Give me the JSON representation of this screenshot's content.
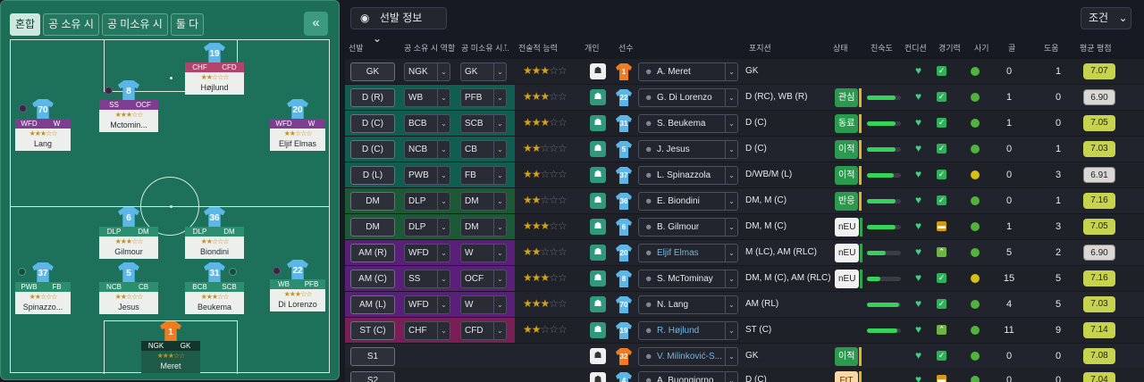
{
  "pitch": {
    "tabs": [
      "혼합",
      "공 소유 시",
      "공 미소유 시",
      "둘 다"
    ],
    "active_tab": "혼합",
    "collapse_label": "«",
    "tokens": [
      {
        "num": "19",
        "roles": [
          "CHF",
          "CFD"
        ],
        "stars": "★★☆☆☆",
        "name": "Højlund",
        "kit": "outfield",
        "scheme": "pk"
      },
      {
        "num": "8",
        "roles": [
          "SS",
          "OCF"
        ],
        "stars": "★★★☆☆",
        "name": "Mctomin...",
        "kit": "outfield",
        "scheme": "pur"
      },
      {
        "num": "70",
        "roles": [
          "WFD",
          "W"
        ],
        "stars": "★★★☆☆",
        "name": "Lang",
        "kit": "outfield",
        "scheme": "pur"
      },
      {
        "num": "20",
        "roles": [
          "WFD",
          "W"
        ],
        "stars": "★★☆☆☆",
        "name": "Eljif Elmas",
        "kit": "outfield",
        "scheme": "pur"
      },
      {
        "num": "6",
        "roles": [
          "DLP",
          "DM"
        ],
        "stars": "★★★☆☆",
        "name": "Gilmour",
        "kit": "outfield",
        "scheme": "gr"
      },
      {
        "num": "36",
        "roles": [
          "DLP",
          "DM"
        ],
        "stars": "★★☆☆☆",
        "name": "Biondini",
        "kit": "outfield",
        "scheme": "gr"
      },
      {
        "num": "37",
        "roles": [
          "PWB",
          "FB"
        ],
        "stars": "★★☆☆☆",
        "name": "Spinazzo...",
        "kit": "outfield",
        "scheme": "gr"
      },
      {
        "num": "5",
        "roles": [
          "NCB",
          "CB"
        ],
        "stars": "★★☆☆☆",
        "name": "Jesus",
        "kit": "outfield",
        "scheme": "gr"
      },
      {
        "num": "31",
        "roles": [
          "BCB",
          "SCB"
        ],
        "stars": "★★★☆☆",
        "name": "Beukema",
        "kit": "outfield",
        "scheme": "gr"
      },
      {
        "num": "22",
        "roles": [
          "WB",
          "PFB"
        ],
        "stars": "★★★☆☆",
        "name": "Di Lorenzo",
        "kit": "outfield",
        "scheme": "gr"
      },
      {
        "num": "1",
        "roles": [
          "NGK",
          "GK"
        ],
        "stars": "★★★☆☆",
        "name": "Meret",
        "kit": "gk",
        "scheme": "dk"
      }
    ]
  },
  "toolbar": {
    "view_label": "선발 정보",
    "filter_label": "조건"
  },
  "columns": {
    "sel": "선발",
    "role": "공 소유 시 역할",
    "duty": "공 미소유 시...",
    "stars": "전술적 능력",
    "person": "개인",
    "player": "선수",
    "position": "포지션",
    "status": "상태",
    "familiarity": "친숙도",
    "condition": "컨디션",
    "fitness": "경기력",
    "morale": "사기",
    "goals": "골",
    "assists": "도움",
    "rating": "평균 평점"
  },
  "accent": {
    "gk": "#2d3039",
    "def": "#0f6e5c",
    "mid": "#1f6e40",
    "att": "#6a1f8a",
    "st": "#8a1f5a"
  },
  "rows": [
    {
      "sel": "GK",
      "role": "NGK",
      "duty": "GK",
      "stars": "★★★",
      "stars_off": "☆☆",
      "person": "w",
      "num": "1",
      "kit": "gk",
      "name": "A. Meret",
      "blue": false,
      "pos": "GK",
      "status": "",
      "status_cls": "",
      "fam": 0,
      "fit": "check",
      "morale": "g",
      "goals": "0",
      "assists": "1",
      "rating": "7.07",
      "rating_cls": "",
      "strip": "gk"
    },
    {
      "sel": "D (R)",
      "role": "WB",
      "duty": "PFB",
      "stars": "★★★",
      "stars_off": "☆☆",
      "person": "g",
      "num": "22",
      "kit": "out",
      "name": "G. Di Lorenzo",
      "blue": false,
      "pos": "D (RC), WB (R)",
      "status": "관심",
      "status_cls": "s-green",
      "fam": 85,
      "fit": "check",
      "morale": "g",
      "goals": "1",
      "assists": "0",
      "rating": "6.90",
      "rating_cls": "gray",
      "strip": "def"
    },
    {
      "sel": "D (C)",
      "role": "BCB",
      "duty": "SCB",
      "stars": "★★★",
      "stars_off": "☆☆",
      "person": "g",
      "num": "31",
      "kit": "out",
      "name": "S. Beukema",
      "blue": false,
      "pos": "D (C)",
      "status": "동료",
      "status_cls": "s-green",
      "fam": 85,
      "fit": "check",
      "morale": "g",
      "goals": "1",
      "assists": "0",
      "rating": "7.05",
      "rating_cls": "",
      "strip": "def"
    },
    {
      "sel": "D (C)",
      "role": "NCB",
      "duty": "CB",
      "stars": "★★",
      "stars_off": "☆☆☆",
      "person": "g",
      "num": "5",
      "kit": "out",
      "name": "J. Jesus",
      "blue": false,
      "pos": "D (C)",
      "status": "이적",
      "status_cls": "s-green",
      "fam": 85,
      "fit": "check",
      "morale": "g",
      "goals": "0",
      "assists": "1",
      "rating": "7.03",
      "rating_cls": "",
      "strip": "def"
    },
    {
      "sel": "D (L)",
      "role": "PWB",
      "duty": "FB",
      "stars": "★★",
      "stars_off": "☆☆☆",
      "person": "g",
      "num": "37",
      "kit": "out",
      "name": "L. Spinazzola",
      "blue": false,
      "pos": "D/WB/M (L)",
      "status": "이적",
      "status_cls": "s-green",
      "fam": 80,
      "fit": "check",
      "morale": "y",
      "goals": "0",
      "assists": "3",
      "rating": "6.91",
      "rating_cls": "gray",
      "strip": "def"
    },
    {
      "sel": "DM",
      "role": "DLP",
      "duty": "DM",
      "stars": "★★",
      "stars_off": "☆☆☆",
      "person": "g",
      "num": "36",
      "kit": "out",
      "name": "E. Biondini",
      "blue": false,
      "pos": "DM, M (C)",
      "status": "반응",
      "status_cls": "s-green",
      "fam": 85,
      "fit": "check",
      "morale": "g",
      "goals": "0",
      "assists": "1",
      "rating": "7.16",
      "rating_cls": "",
      "strip": "mid"
    },
    {
      "sel": "DM",
      "role": "DLP",
      "duty": "DM",
      "stars": "★★★",
      "stars_off": "☆☆",
      "person": "g",
      "num": "6",
      "kit": "out",
      "name": "B. Gilmour",
      "blue": false,
      "pos": "DM, M (C)",
      "status": "nEU",
      "status_cls": "s-white",
      "fam": 85,
      "fit": "amber",
      "morale": "g",
      "goals": "1",
      "assists": "3",
      "rating": "7.05",
      "rating_cls": "",
      "strip": "mid"
    },
    {
      "sel": "AM (R)",
      "role": "WFD",
      "duty": "W",
      "stars": "★★",
      "stars_off": "☆☆☆",
      "person": "g",
      "num": "20",
      "kit": "out",
      "name": "Eljif Elmas",
      "blue": true,
      "pos": "M (LC), AM (RLC)",
      "status": "nEU",
      "status_cls": "s-white",
      "fam": 55,
      "fit": "green2",
      "morale": "g",
      "goals": "5",
      "assists": "2",
      "rating": "6.90",
      "rating_cls": "gray",
      "strip": "att"
    },
    {
      "sel": "AM (C)",
      "role": "SS",
      "duty": "OCF",
      "stars": "★★★",
      "stars_off": "☆☆",
      "person": "g",
      "num": "8",
      "kit": "out",
      "name": "S. McTominay",
      "blue": false,
      "pos": "DM, M (C), AM (RLC)",
      "status": "nEU",
      "status_cls": "s-white",
      "fam": 40,
      "fit": "check",
      "morale": "y",
      "goals": "15",
      "assists": "5",
      "rating": "7.16",
      "rating_cls": "",
      "strip": "att"
    },
    {
      "sel": "AM (L)",
      "role": "WFD",
      "duty": "W",
      "stars": "★★★",
      "stars_off": "☆☆",
      "person": "g",
      "num": "70",
      "kit": "out",
      "name": "N. Lang",
      "blue": false,
      "pos": "AM (RL)",
      "status": "",
      "status_cls": "",
      "fam": 95,
      "fit": "check",
      "morale": "g",
      "goals": "4",
      "assists": "5",
      "rating": "7.03",
      "rating_cls": "",
      "strip": "att"
    },
    {
      "sel": "ST (C)",
      "role": "CHF",
      "duty": "CFD",
      "stars": "★★",
      "stars_off": "☆☆☆",
      "person": "g",
      "num": "19",
      "kit": "out",
      "name": "R. Højlund",
      "blue": true,
      "pos": "ST (C)",
      "status": "",
      "status_cls": "",
      "fam": 90,
      "fit": "green2",
      "morale": "g",
      "goals": "11",
      "assists": "9",
      "rating": "7.14",
      "rating_cls": "",
      "strip": "st"
    },
    {
      "sel": "S1",
      "role": "",
      "duty": "",
      "stars": "",
      "stars_off": "",
      "person": "w",
      "num": "32",
      "kit": "gk",
      "name": "V. Milinković-S...",
      "blue": true,
      "pos": "GK",
      "status": "이적",
      "status_cls": "s-green",
      "fam": 0,
      "fit": "check",
      "morale": "g",
      "goals": "0",
      "assists": "0",
      "rating": "7.08",
      "rating_cls": "",
      "strip": "none"
    },
    {
      "sel": "S2",
      "role": "",
      "duty": "",
      "stars": "",
      "stars_off": "",
      "person": "w",
      "num": "4",
      "kit": "out",
      "name": "A. Buongiorno",
      "blue": false,
      "pos": "D (C)",
      "status": "FtT",
      "status_cls": "s-orange",
      "fam": 0,
      "fit": "amber",
      "morale": "g",
      "goals": "0",
      "assists": "0",
      "rating": "7.04",
      "rating_cls": "",
      "strip": "none"
    }
  ]
}
